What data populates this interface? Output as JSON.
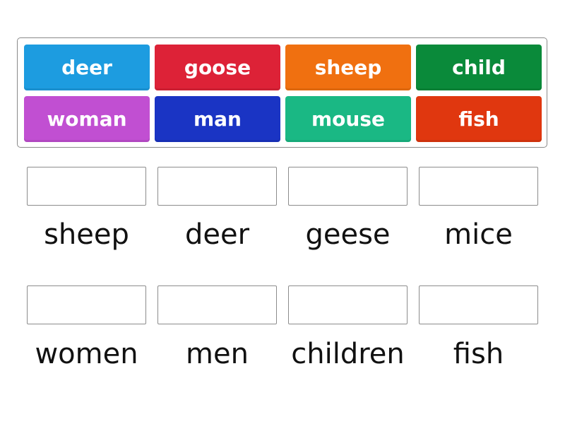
{
  "tiles": [
    {
      "label": "deer",
      "color": "#1d9ce0"
    },
    {
      "label": "goose",
      "color": "#dd2237"
    },
    {
      "label": "sheep",
      "color": "#f07010"
    },
    {
      "label": "child",
      "color": "#0a8a3a"
    },
    {
      "label": "woman",
      "color": "#c14fd2"
    },
    {
      "label": "man",
      "color": "#1a34c4"
    },
    {
      "label": "mouse",
      "color": "#1ab884"
    },
    {
      "label": "fish",
      "color": "#e0370f"
    }
  ],
  "targets": [
    {
      "label": "sheep"
    },
    {
      "label": "deer"
    },
    {
      "label": "geese"
    },
    {
      "label": "mice"
    },
    {
      "label": "women"
    },
    {
      "label": "men"
    },
    {
      "label": "children"
    },
    {
      "label": "fish"
    }
  ]
}
